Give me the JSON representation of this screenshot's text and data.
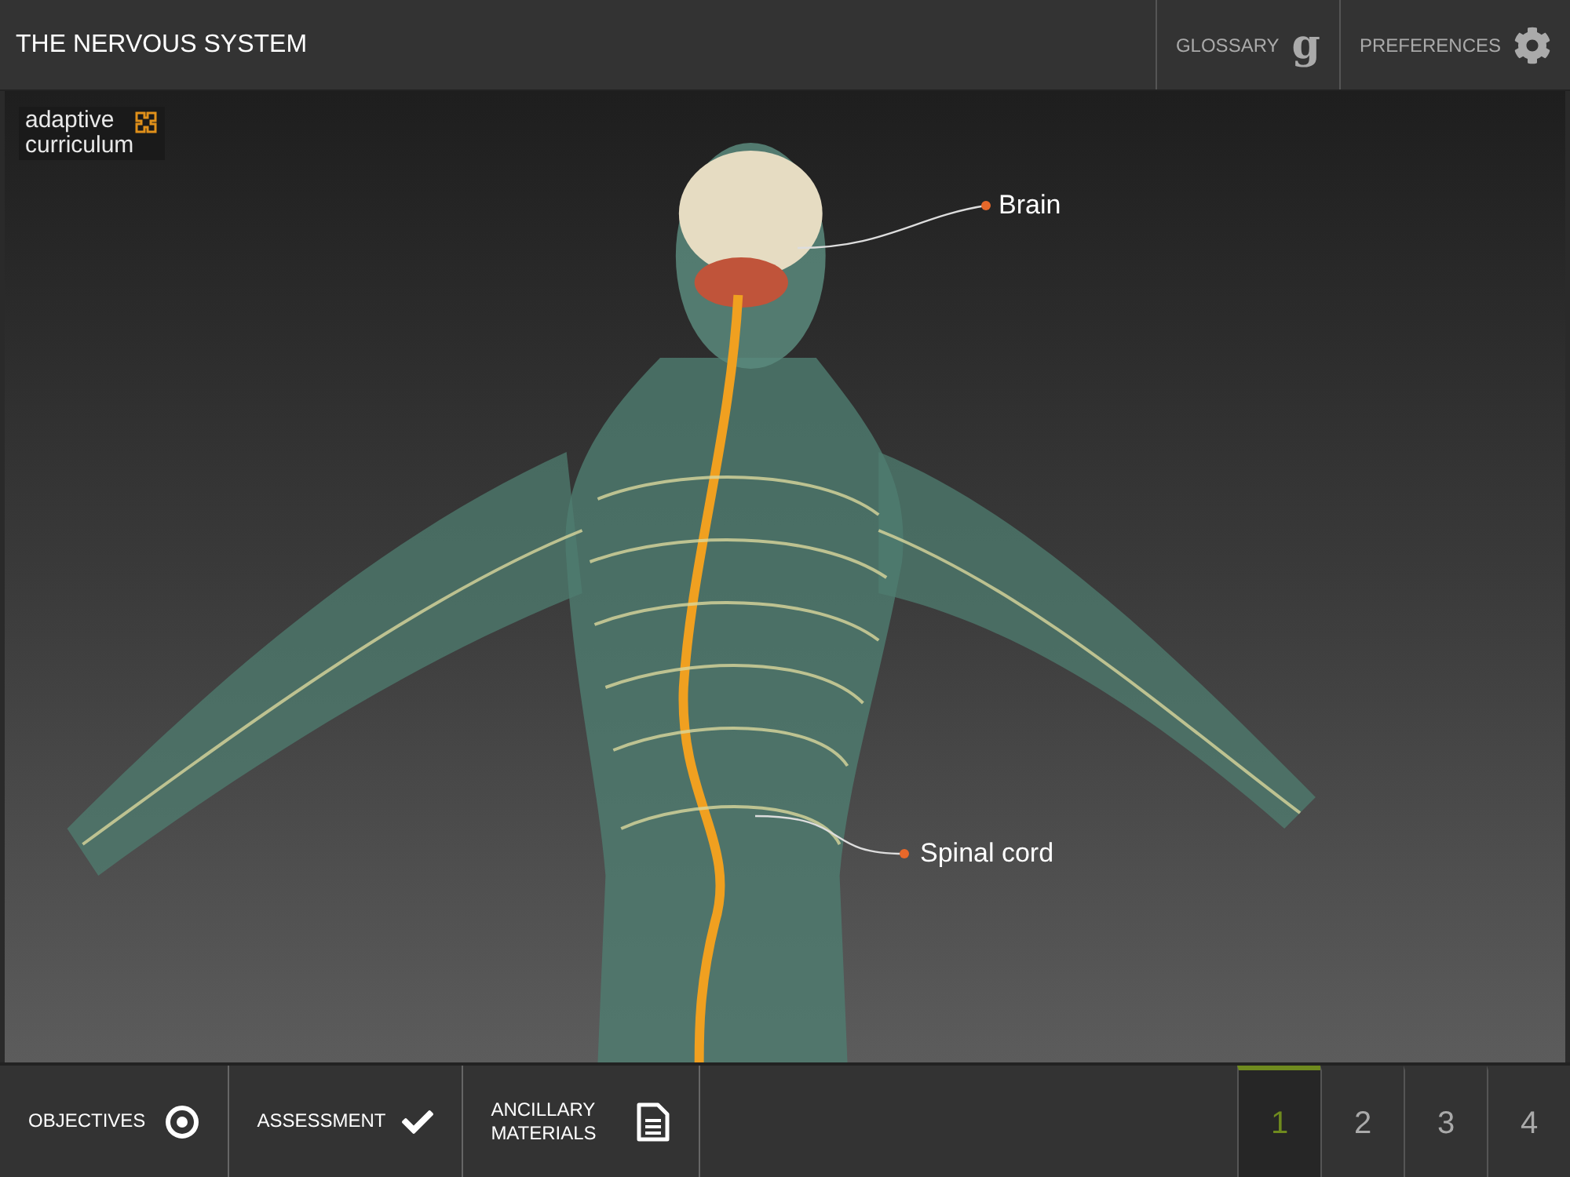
{
  "header": {
    "title": "THE NERVOUS SYSTEM",
    "actions": [
      {
        "label": "GLOSSARY",
        "kind": "glossary",
        "glyph": "g"
      },
      {
        "label": "PREFERENCES",
        "kind": "preferences"
      }
    ]
  },
  "stage": {
    "kind": "picture",
    "logo": {
      "lines": [
        "adaptive",
        "curriculum"
      ]
    },
    "labels": [
      {
        "text": "Brain",
        "kind": "brain"
      },
      {
        "text": "Spinal cord",
        "kind": "spine"
      }
    ]
  },
  "footer": {
    "buttons": [
      {
        "label": "OBJECTIVES",
        "kind": "target"
      },
      {
        "label": "ASSESSMENT",
        "kind": "check"
      },
      {
        "label": "ANCILLARY MATERIALS",
        "kind": "document"
      }
    ],
    "pages": [
      {
        "label": "1",
        "selected": true
      },
      {
        "label": "2",
        "selected": false
      },
      {
        "label": "3",
        "selected": false
      },
      {
        "label": "4",
        "selected": false
      }
    ]
  }
}
